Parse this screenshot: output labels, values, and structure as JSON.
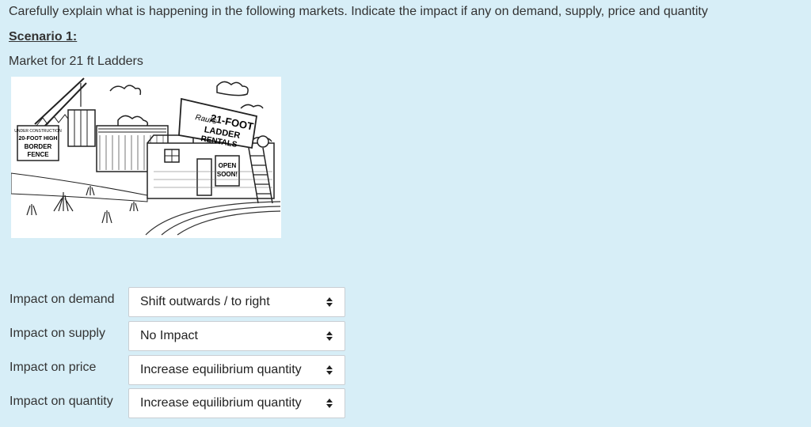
{
  "question": "Carefully explain what is happening in the following markets. Indicate the impact if any on demand, supply, price and quantity",
  "scenario_title": "Scenario 1:",
  "market_title": "Market for 21 ft Ladders",
  "cartoon": {
    "fence_sign": [
      "UNDER CONSTRUCTION",
      "20-FOOT HIGH",
      "BORDER",
      "FENCE"
    ],
    "shop_sign": [
      "Raul's",
      "21-FOOT",
      "LADDER",
      "RENTALS"
    ],
    "door_sign": [
      "OPEN",
      "SOON!"
    ]
  },
  "rows": [
    {
      "label": "Impact on demand",
      "value": "Shift outwards / to right"
    },
    {
      "label": "Impact on supply",
      "value": "No Impact"
    },
    {
      "label": "Impact on price",
      "value": "Increase equilibrium quantity"
    },
    {
      "label": "Impact on quantity",
      "value": "Increase equilibrium quantity"
    }
  ],
  "icons": {
    "select_arrow": "updown-arrows-icon"
  }
}
